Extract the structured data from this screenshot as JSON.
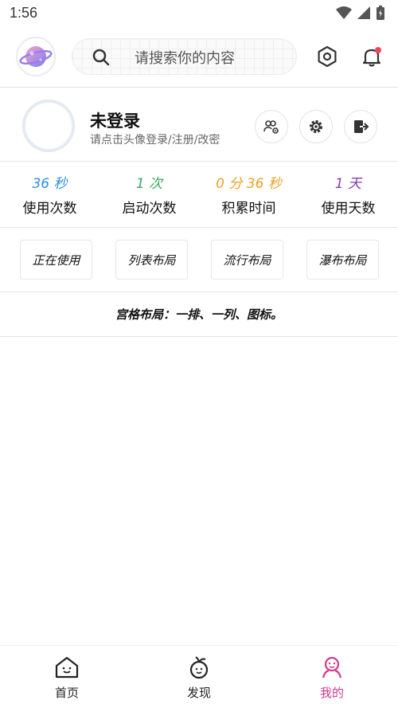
{
  "status_bar": {
    "time": "1:56"
  },
  "header": {
    "search_placeholder": "请搜索你的内容"
  },
  "profile": {
    "name": "未登录",
    "subtitle": "请点击头像登录/注册/改密"
  },
  "stats": [
    {
      "value": "36 秒",
      "label": "使用次数",
      "color": "#2f8de4"
    },
    {
      "value": "1 次",
      "label": "启动次数",
      "color": "#3aa860"
    },
    {
      "value": "0 分 36 秒",
      "label": "积累时间",
      "color": "#f0a020"
    },
    {
      "value": "1 天",
      "label": "使用天数",
      "color": "#8a3ab8"
    }
  ],
  "layouts": [
    {
      "label": "正在使用"
    },
    {
      "label": "列表布局"
    },
    {
      "label": "流行布局"
    },
    {
      "label": "瀑布布局"
    }
  ],
  "grid_note": "宫格布局：一排、一列、图标。",
  "bottom_nav": [
    {
      "label": "首页",
      "active": false
    },
    {
      "label": "发现",
      "active": false
    },
    {
      "label": "我的",
      "active": true
    }
  ],
  "colors": {
    "active_tab": "#d63a8a",
    "inactive_tab": "#222222",
    "notification_dot": "#f0465a"
  }
}
